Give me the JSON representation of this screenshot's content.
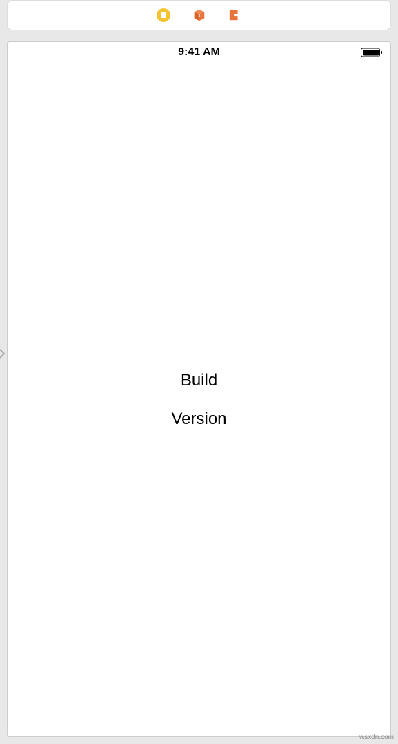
{
  "toolbar": {
    "stop_icon": "stop",
    "cube_icon": "cube",
    "exit_icon": "exit"
  },
  "status_bar": {
    "time": "9:41 AM"
  },
  "content": {
    "build_label": "Build",
    "version_label": "Version"
  },
  "watermark": "wsxdn.com",
  "colors": {
    "toolbar_yellow": "#f4c430",
    "toolbar_orange": "#e8743b"
  }
}
